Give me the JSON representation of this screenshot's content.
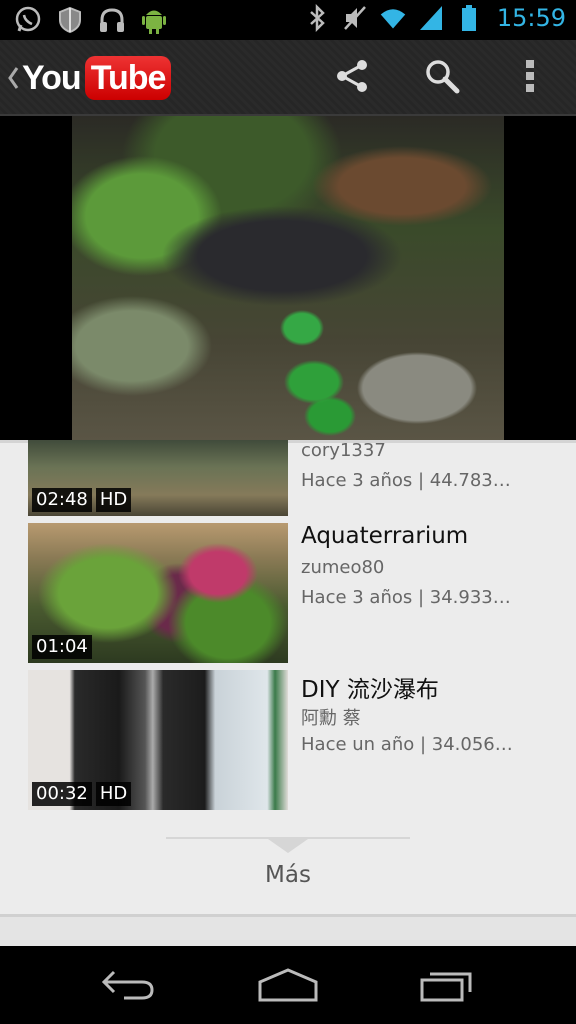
{
  "status_bar": {
    "time": "15:59",
    "icons_left": [
      "whatsapp-icon",
      "shield-icon",
      "headphones-icon",
      "android-icon"
    ],
    "icons_right": [
      "bluetooth-icon",
      "mute-icon",
      "wifi-icon",
      "signal-icon",
      "battery-icon"
    ],
    "time_color": "#33b5e5"
  },
  "app_bar": {
    "logo_you": "You",
    "logo_tube": "Tube",
    "actions": [
      "share-icon",
      "search-icon",
      "overflow-menu-icon"
    ]
  },
  "videos": [
    {
      "title": "",
      "channel": "cory1337",
      "meta": "Hace 3 años | 44.783…",
      "duration": "02:48",
      "hd": "HD"
    },
    {
      "title": "Aquaterrarium",
      "channel": "zumeo80",
      "meta": "Hace 3 años | 34.933…",
      "duration": "01:04",
      "hd": ""
    },
    {
      "title": "DIY 流沙瀑布",
      "channel": "阿勳 蔡",
      "meta": "Hace un año | 34.056…",
      "duration": "00:32",
      "hd": "HD"
    }
  ],
  "more_label": "Más",
  "nav_bar": [
    "back-icon",
    "home-icon",
    "recent-apps-icon"
  ]
}
